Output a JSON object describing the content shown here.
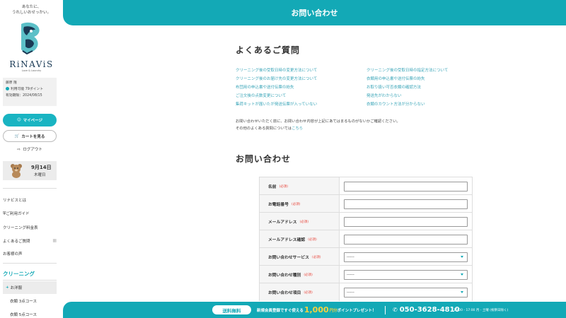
{
  "sidebar": {
    "tagline": [
      "あなたに、",
      "うれしいおせっかい。"
    ],
    "logo_text": "RiNAViS",
    "logo_sub": "Love & Laundry",
    "user": {
      "name": "藤原 隆",
      "points": "利用可能 79ポイント",
      "expiry": "有効期限：2024/08/15"
    },
    "mypage_label": "マイページ",
    "cart_label": "カートを見る",
    "logout_label": "ログアウト",
    "date": {
      "main": "9月14日",
      "weekday": "木曜日"
    },
    "nav": [
      {
        "label": "リナビスとは"
      },
      {
        "label": "ご利用ガイド"
      },
      {
        "label": "クリーニング料金表"
      },
      {
        "label": "よくあるご質問"
      },
      {
        "label": "お客様の声"
      }
    ],
    "section_cleaning": "クリーニング",
    "sub_items": [
      {
        "label": "お洋服"
      },
      {
        "label": "衣類 3点コース"
      },
      {
        "label": "衣類 5点コース"
      }
    ]
  },
  "header": {
    "title": "お問い合わせ"
  },
  "faq": {
    "title": "よくあるご質問",
    "links_left": [
      "クリーニング後の受取日時の変更方法について",
      "クリーニング後のお届け先の変更方法について",
      "布団用の申込書や送付伝票の紛失",
      "ご注文後の点数変更について",
      "集荷キットが届いたが発送伝票が入っていない"
    ],
    "links_right": [
      "クリーニング後の受取日時の指定方法について",
      "衣類用の申込書や送付伝票の紛失",
      "お取り扱い可否衣類の確認方法",
      "発送先がわからない",
      "衣類のカウント方法が分からない"
    ],
    "note_line1": "お問い合わせいただく前に、お問い合わせ内容が上記にあてはまるものがないかご確認ください。",
    "note_line2_prefix": "その他のよくある質問については",
    "note_link": "こちら"
  },
  "contact": {
    "title": "お問い合わせ",
    "required_label": "(必須)",
    "fields": [
      {
        "label": "名前",
        "type": "text",
        "value": ""
      },
      {
        "label": "お電話番号",
        "type": "text",
        "value": ""
      },
      {
        "label": "メールアドレス",
        "type": "text",
        "value": ""
      },
      {
        "label": "メールアドレス確認",
        "type": "text",
        "value": ""
      },
      {
        "label": "お問い合わせサービス",
        "type": "select",
        "value": "------"
      },
      {
        "label": "お問い合わせ種別",
        "type": "select",
        "value": "------"
      },
      {
        "label": "お問い合わせ項目",
        "type": "select",
        "value": "------"
      }
    ]
  },
  "footer": {
    "free_label": "送料無料",
    "promo_prefix": "新規会員登録ですぐ使える",
    "promo_amount": "1,000",
    "promo_unit": "円分",
    "promo_suffix": "ポイントプレゼント！",
    "phone": "050-3628-4810",
    "hours": "10:00 - 17:00 月 - 土曜 (祝祭日除く)"
  },
  "colors": {
    "accent": "#13a9b6",
    "required": "#e8473d",
    "promo": "#f7d23e",
    "link": "#3aa5b8"
  }
}
